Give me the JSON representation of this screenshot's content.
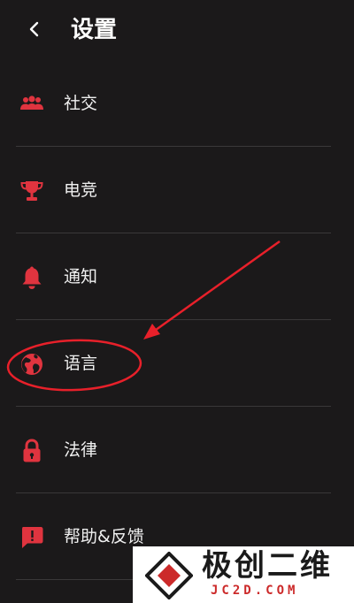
{
  "header": {
    "title": "设置",
    "back_icon": "chevron-left-icon"
  },
  "menu": {
    "items": [
      {
        "label": "社交",
        "icon": "people-group-icon"
      },
      {
        "label": "电竞",
        "icon": "trophy-icon"
      },
      {
        "label": "通知",
        "icon": "bell-icon"
      },
      {
        "label": "语言",
        "icon": "globe-icon"
      },
      {
        "label": "法律",
        "icon": "lock-icon"
      },
      {
        "label": "帮助&反馈",
        "icon": "feedback-icon"
      }
    ]
  },
  "watermark": {
    "title": "极创二维",
    "subtitle": "JC2D.COM"
  },
  "colors": {
    "background": "#1b191a",
    "accent": "#e0343f",
    "annotation": "#e8202a",
    "divider": "#3a3839"
  }
}
